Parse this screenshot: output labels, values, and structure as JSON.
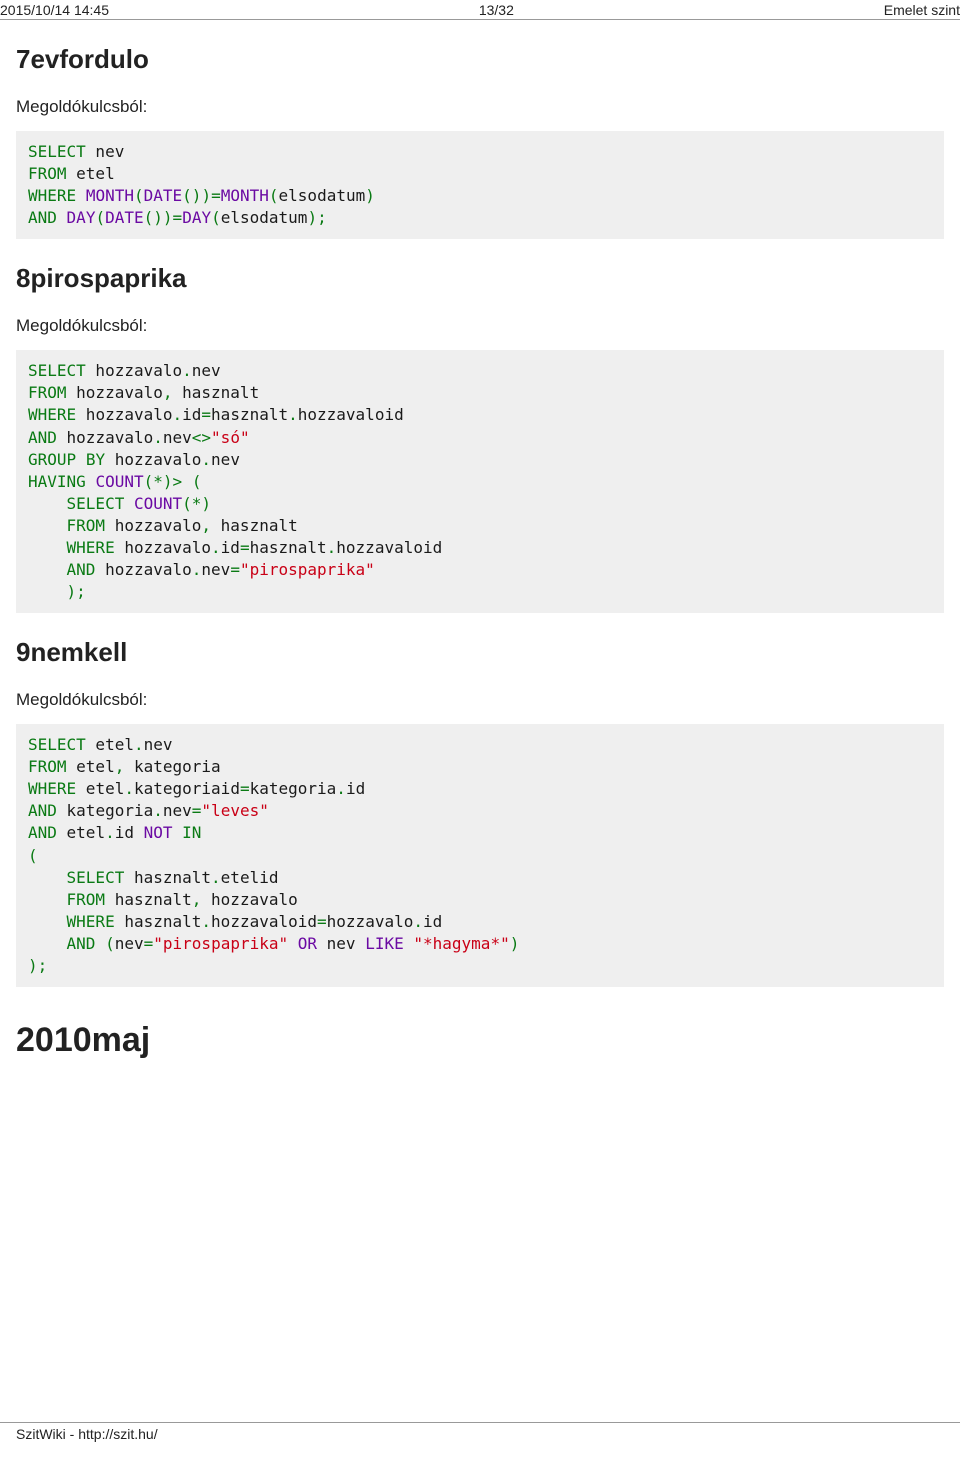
{
  "header": {
    "datetime": "2015/10/14 14:45",
    "pageinfo": "13/32",
    "title": "Emelet szint"
  },
  "sections": {
    "s1": {
      "heading": "7evfordulo",
      "lead": "Megoldókulcsból:"
    },
    "s2": {
      "heading": "8pirospaprika",
      "lead": "Megoldókulcsból:"
    },
    "s3": {
      "heading": "9nemkell",
      "lead": "Megoldókulcsból:"
    },
    "s4": {
      "heading": "2010maj"
    }
  },
  "code1": {
    "l1a": "SELECT",
    "l1b": " nev",
    "l2a": "FROM",
    "l2b": " etel",
    "l3a": "WHERE",
    "l3b": " ",
    "l3c": "MONTH",
    "l3d": "(",
    "l3e": "DATE",
    "l3f": "(",
    "l3g": ")",
    "l3h": ")",
    "l3i": "=",
    "l3j": "MONTH",
    "l3k": "(",
    "l3l": "elsodatum",
    "l3m": ")",
    "l4a": "AND",
    "l4b": " ",
    "l4c": "DAY",
    "l4d": "(",
    "l4e": "DATE",
    "l4f": "(",
    "l4g": ")",
    "l4h": ")",
    "l4i": "=",
    "l4j": "DAY",
    "l4k": "(",
    "l4l": "elsodatum",
    "l4m": ")",
    "l4n": ";"
  },
  "code2": {
    "l1a": "SELECT",
    "l1b": " hozzavalo",
    "l1c": ".",
    "l1d": "nev",
    "l2a": "FROM",
    "l2b": " hozzavalo",
    "l2c": ",",
    "l2d": " hasznalt",
    "l3a": "WHERE",
    "l3b": " hozzavalo",
    "l3c": ".",
    "l3d": "id",
    "l3e": "=",
    "l3f": "hasznalt",
    "l3g": ".",
    "l3h": "hozzavaloid",
    "l4a": "AND",
    "l4b": " hozzavalo",
    "l4c": ".",
    "l4d": "nev",
    "l4e": "<>",
    "l4f": "\"só\"",
    "l5a": "GROUP",
    "l5b": " ",
    "l5c": "BY",
    "l5d": " hozzavalo",
    "l5e": ".",
    "l5f": "nev",
    "l6a": "HAVING",
    "l6b": " ",
    "l6c": "COUNT",
    "l6d": "(",
    "l6e": "*",
    "l6f": ")",
    "l6g": ">",
    "l6h": " ",
    "l6i": "(",
    "l7a": "    ",
    "l7b": "SELECT",
    "l7c": " ",
    "l7d": "COUNT",
    "l7e": "(",
    "l7f": "*",
    "l7g": ")",
    "l8a": "    ",
    "l8b": "FROM",
    "l8c": " hozzavalo",
    "l8d": ",",
    "l8e": " hasznalt",
    "l9a": "    ",
    "l9b": "WHERE",
    "l9c": " hozzavalo",
    "l9d": ".",
    "l9e": "id",
    "l9f": "=",
    "l9g": "hasznalt",
    "l9h": ".",
    "l9i": "hozzavaloid",
    "l10a": "    ",
    "l10b": "AND",
    "l10c": " hozzavalo",
    "l10d": ".",
    "l10e": "nev",
    "l10f": "=",
    "l10g": "\"pirospaprika\"",
    "l11a": "    ",
    "l11b": ")",
    "l11c": ";"
  },
  "code3": {
    "l1a": "SELECT",
    "l1b": " etel",
    "l1c": ".",
    "l1d": "nev",
    "l2a": "FROM",
    "l2b": " etel",
    "l2c": ",",
    "l2d": " kategoria",
    "l3a": "WHERE",
    "l3b": " etel",
    "l3c": ".",
    "l3d": "kategoriaid",
    "l3e": "=",
    "l3f": "kategoria",
    "l3g": ".",
    "l3h": "id",
    "l4a": "AND",
    "l4b": " kategoria",
    "l4c": ".",
    "l4d": "nev",
    "l4e": "=",
    "l4f": "\"leves\"",
    "l5a": "AND",
    "l5b": " etel",
    "l5c": ".",
    "l5d": "id ",
    "l5e": "NOT",
    "l5f": " ",
    "l5g": "IN",
    "l6a": "(",
    "l7a": "    ",
    "l7b": "SELECT",
    "l7c": " hasznalt",
    "l7d": ".",
    "l7e": "etelid",
    "l8a": "    ",
    "l8b": "FROM",
    "l8c": " hasznalt",
    "l8d": ",",
    "l8e": " hozzavalo",
    "l9a": "    ",
    "l9b": "WHERE",
    "l9c": " hasznalt",
    "l9d": ".",
    "l9e": "hozzavaloid",
    "l9f": "=",
    "l9g": "hozzavalo",
    "l9h": ".",
    "l9i": "id",
    "l10a": "    ",
    "l10b": "AND",
    "l10c": " ",
    "l10d": "(",
    "l10e": "nev",
    "l10f": "=",
    "l10g": "\"pirospaprika\"",
    "l10h": " ",
    "l10i": "OR",
    "l10j": " nev ",
    "l10k": "LIKE",
    "l10l": " ",
    "l10m": "\"*hagyma*\"",
    "l10n": ")",
    "l11a": ")",
    "l11b": ";"
  },
  "footer": {
    "text": "SzitWiki - http://szit.hu/"
  }
}
